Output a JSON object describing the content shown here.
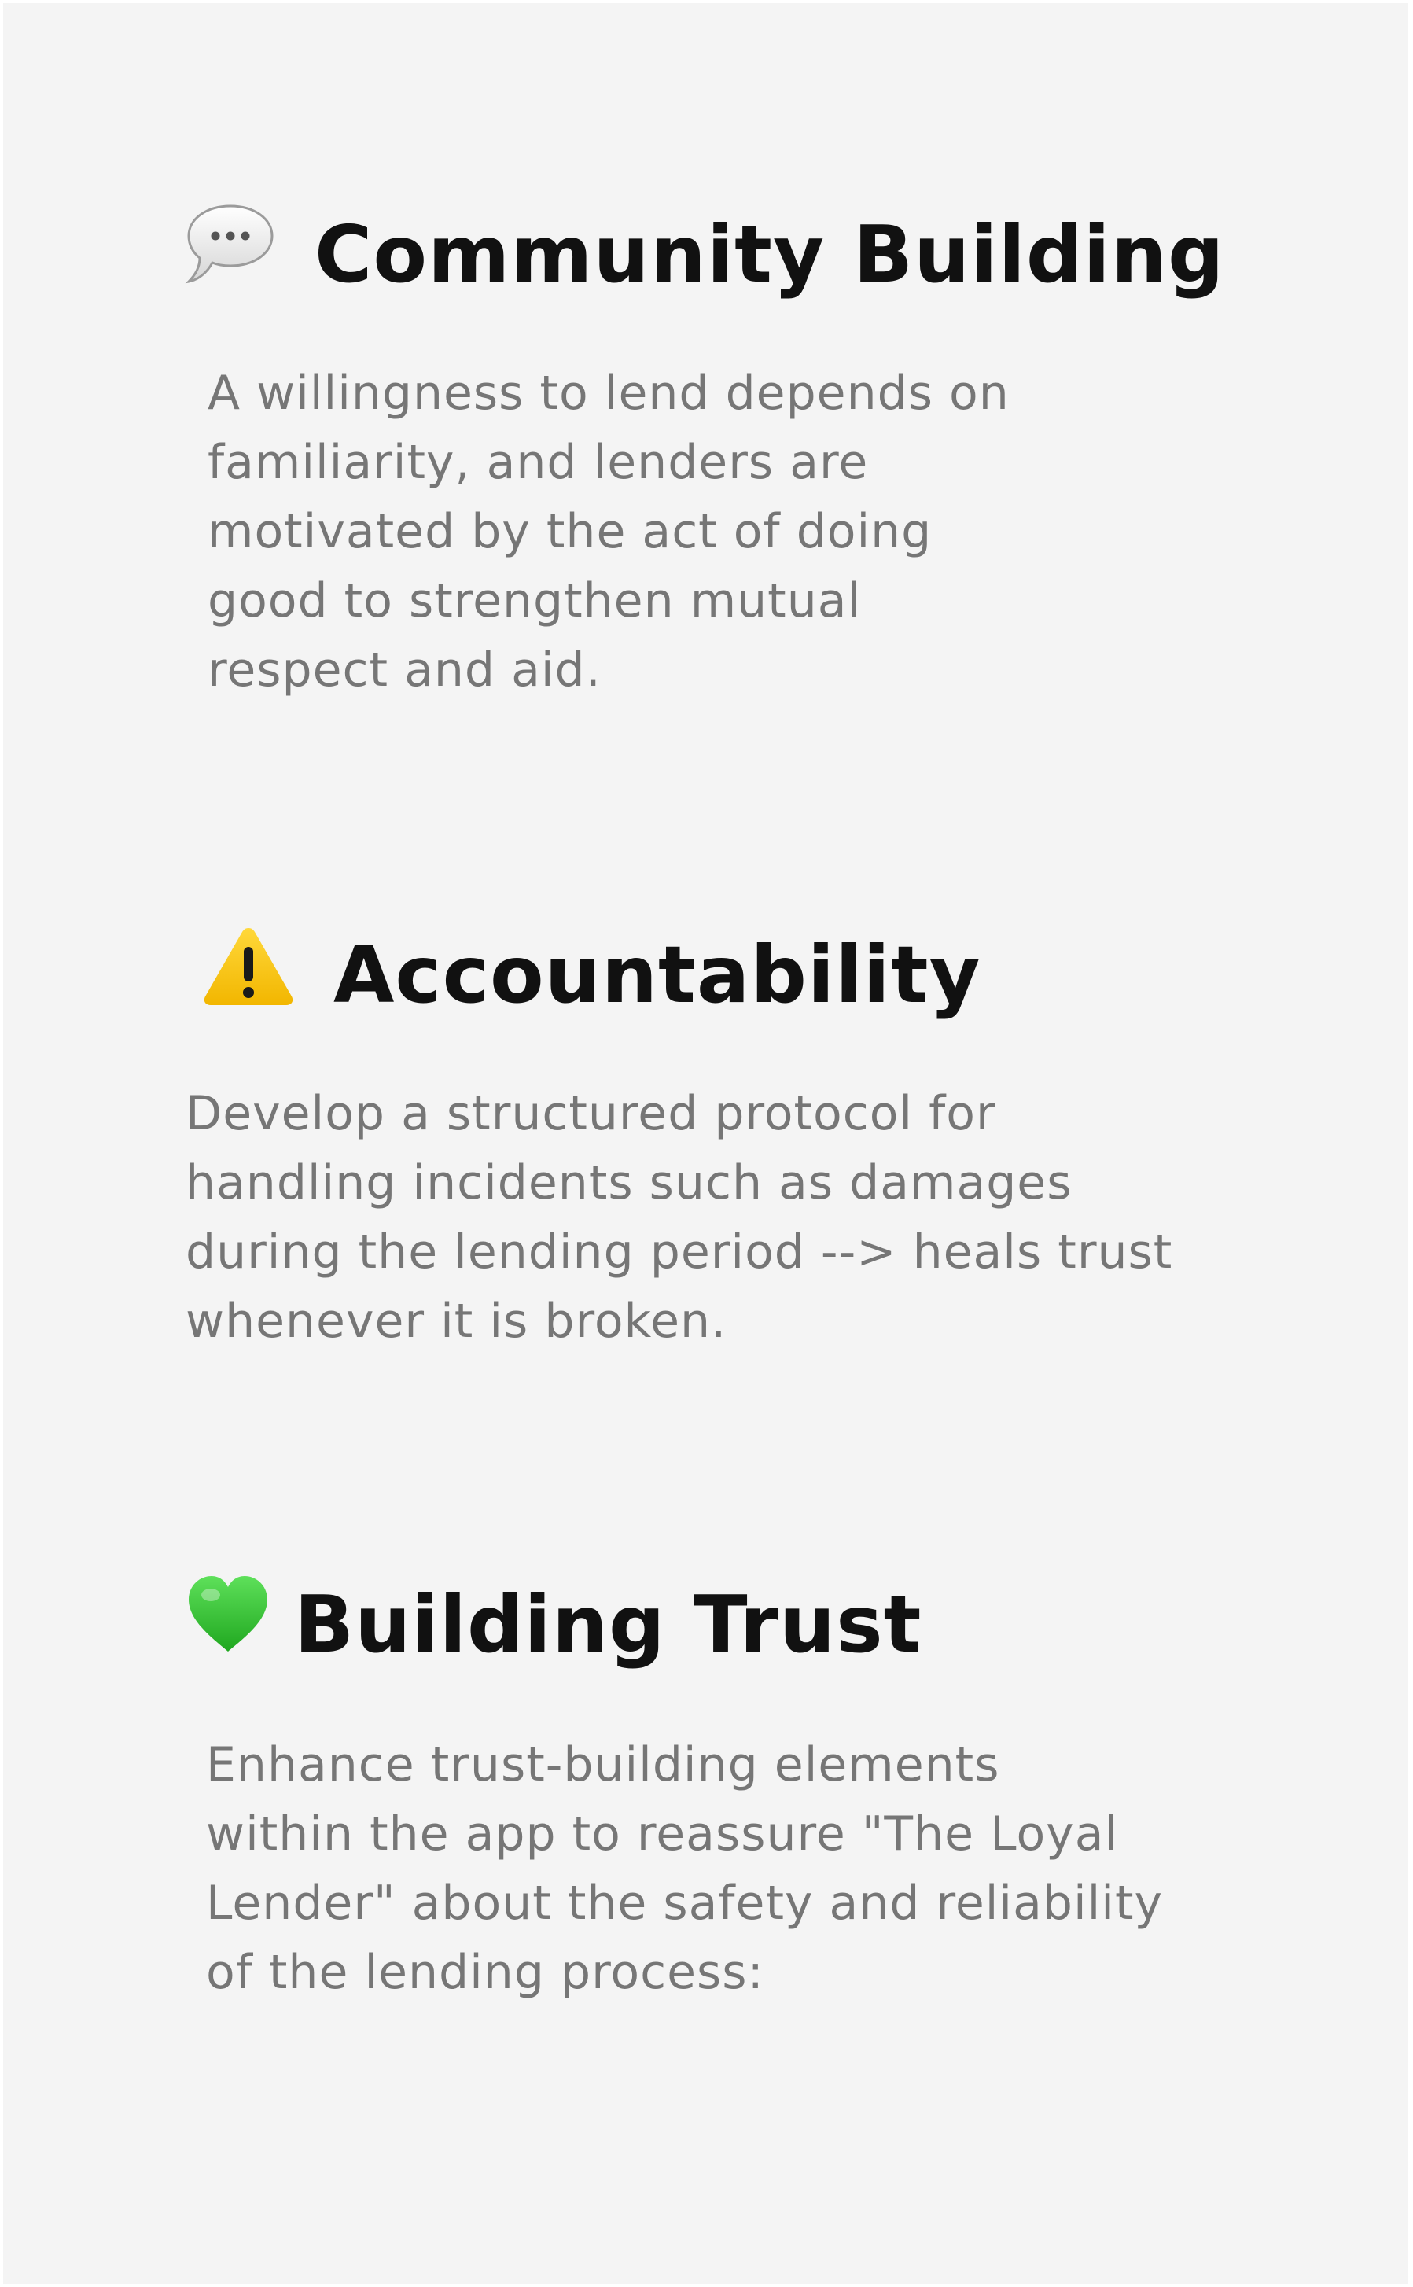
{
  "sections": [
    {
      "icon": "speech-bubble-icon",
      "title": "Community Building",
      "lines": [
        "A willingness to lend depends on",
        "familiarity, and lenders are",
        "motivated by the act of doing",
        "good to strengthen mutual",
        "respect and aid."
      ]
    },
    {
      "icon": "warning-icon",
      "title": "Accountability",
      "lines": [
        "Develop a structured protocol for",
        "handling incidents such as damages",
        "during the lending period --> heals trust",
        "whenever it is broken."
      ]
    },
    {
      "icon": "green-heart-icon",
      "title": "Building Trust",
      "lines": [
        "Enhance trust-building elements",
        "within the app to reassure \"The Loyal",
        "Lender\" about the safety and reliability",
        "of the lending process:"
      ]
    }
  ],
  "colors": {
    "background": "#f4f4f4",
    "heading": "#111111",
    "body": "#767676",
    "warning": "#f7c417",
    "heart": "#3bc93a"
  }
}
